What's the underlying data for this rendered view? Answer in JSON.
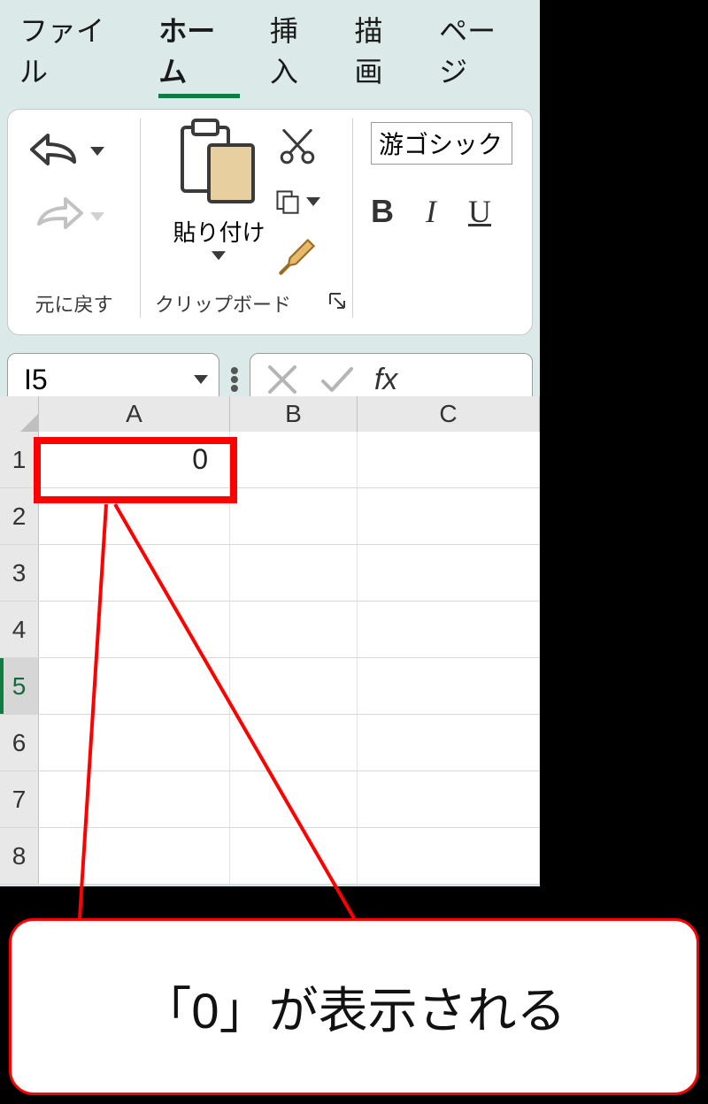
{
  "menu": {
    "file": "ファイル",
    "home": "ホーム",
    "insert": "挿入",
    "draw": "描画",
    "page": "ページ"
  },
  "ribbon": {
    "undo_group_label": "元に戻す",
    "clipboard_group_label": "クリップボード",
    "paste_label": "貼り付け",
    "font_name": "游ゴシック",
    "bold": "B",
    "italic": "I",
    "underline": "U"
  },
  "formula_bar": {
    "namebox": "I5",
    "fx_label": "fx"
  },
  "grid": {
    "columns": [
      "A",
      "B",
      "C"
    ],
    "rows": [
      "1",
      "2",
      "3",
      "4",
      "5",
      "6",
      "7",
      "8"
    ],
    "selected_row": "5",
    "cell_a1": "0"
  },
  "annotation": {
    "callout": "「0」が表示される"
  }
}
